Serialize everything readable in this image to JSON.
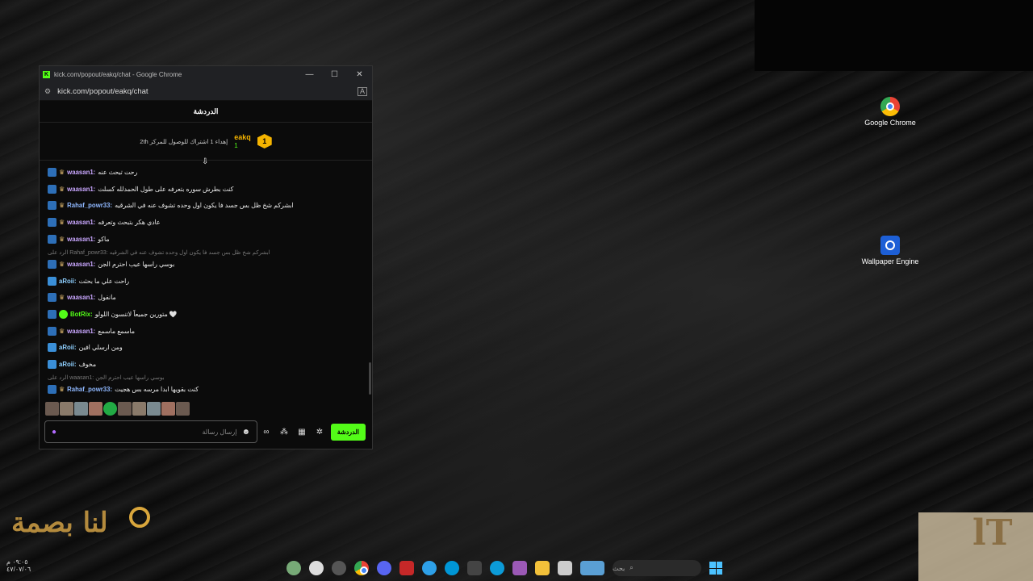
{
  "window": {
    "title": "kick.com/popout/eakq/chat - Google Chrome",
    "url": "kick.com/popout/eakq/chat",
    "controls": [
      "—",
      "☐",
      "✕"
    ]
  },
  "chat": {
    "header": "الدردشة",
    "pinned": {
      "badge": "1",
      "user": "eakq",
      "count": "1",
      "text": "إهداء 1 اشتراك للوصول للمركز 2",
      "suffix": "th"
    },
    "messages": [
      {
        "user": "waasan1:",
        "text": "رحت تبحث عنه",
        "badge": "arrow",
        "crown": true,
        "uclass": "u2"
      },
      {
        "user": "waasan1:",
        "text": "كنت بطرش سوره بتعرفه على طول الحمدلله كسلت",
        "badge": "arrow",
        "crown": true,
        "uclass": "u2"
      },
      {
        "user": "Rahaf_powr33:",
        "text": "ابشركم شخ ظل بس جسد فا يكون اول وحده تشوف عنه في الشرقيه",
        "badge": "arrow",
        "crown": true,
        "uclass": "u1"
      },
      {
        "user": "waasan1:",
        "text": "عادي هكر بتبحث وتعرفه",
        "badge": "arrow",
        "crown": true,
        "uclass": "u2"
      },
      {
        "user": "waasan1:",
        "text": "ماكو",
        "badge": "arrow",
        "crown": true,
        "uclass": "u2"
      },
      {
        "user": "waasan1:",
        "text": "بوسي راسها عيب احترم الجن",
        "badge": "arrow",
        "crown": true,
        "uclass": "u2"
      },
      {
        "user": "aRoii:",
        "text": "راحت علي ما بحثت",
        "badge": "b2",
        "crown": false,
        "uclass": "u3"
      },
      {
        "user": "waasan1:",
        "text": "مانفول",
        "badge": "arrow",
        "crown": true,
        "uclass": "u2"
      },
      {
        "user": "BotRix:",
        "text": "متورين جميعاً لاتنسون اللولو 🤍",
        "badge": "arrow",
        "crown": false,
        "uclass": "u4"
      },
      {
        "user": "waasan1:",
        "text": "ماسمع ماسمع",
        "badge": "arrow",
        "crown": true,
        "uclass": "u2"
      },
      {
        "user": "aRoii:",
        "text": "ومن ارسلي افين",
        "badge": "b2",
        "crown": false,
        "uclass": "u3"
      },
      {
        "user": "aRoii:",
        "text": "مخوف",
        "badge": "b2",
        "crown": false,
        "uclass": "u3"
      },
      {
        "user": "Rahaf_powr33:",
        "text": "كنت بقويها ابدا مرسه بس هجيت",
        "badge": "arrow",
        "crown": true,
        "uclass": "u1"
      }
    ],
    "reply1": "الرد على Rahaf_powr33: ابشركم شخ ظل بس جسد فا يكون اول وحده تشوف عنه في الشرقيه",
    "reply2": "الرد على waasan1: بوسي راسها عيب احترم الجن",
    "input_placeholder": "إرسال رسالة",
    "send_label": "الدردشة"
  },
  "desktop": {
    "icons": [
      {
        "label": "Google Chrome",
        "icon": "chrome-icon"
      },
      {
        "label": "Wallpaper Engine",
        "icon": "wallpaper-engine-icon"
      }
    ]
  },
  "watermark": {
    "left_text": "لنا بصمة",
    "time": "٠٩:٠٥ م",
    "date": "٤٧/٠٧/٠٦",
    "right_text": "lT"
  },
  "taskbar": {
    "search_placeholder": "بحث"
  }
}
